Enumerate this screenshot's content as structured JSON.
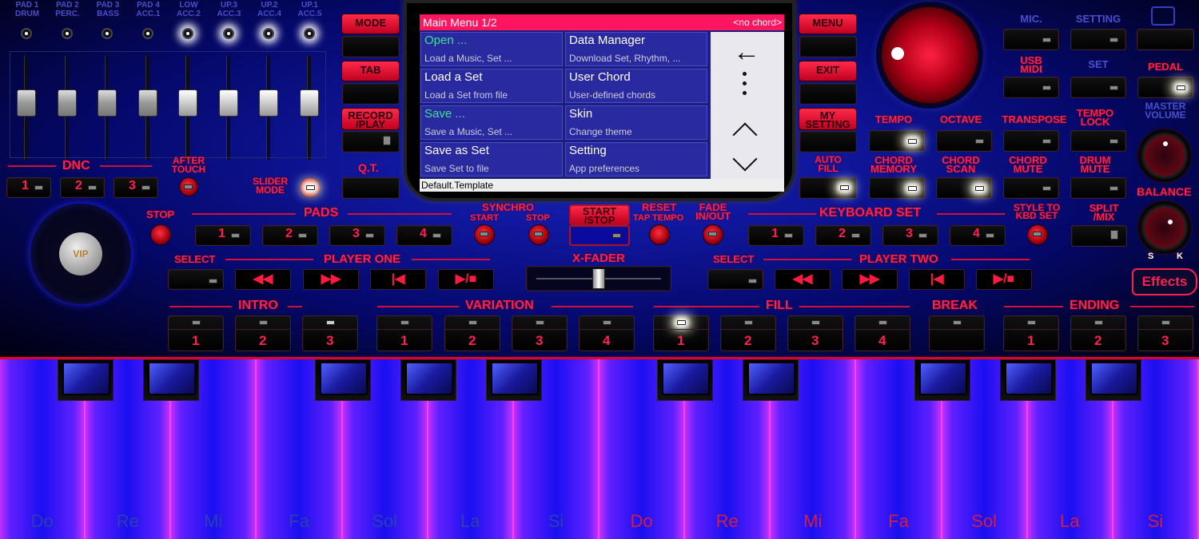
{
  "mixer": {
    "channels": [
      {
        "top": "PAD 1",
        "bottom": "DRUM",
        "led_on": false,
        "level": 0.4
      },
      {
        "top": "PAD 2",
        "bottom": "PERC.",
        "led_on": false,
        "level": 0.4
      },
      {
        "top": "PAD 3",
        "bottom": "BASS",
        "led_on": false,
        "level": 0.4
      },
      {
        "top": "PAD 4",
        "bottom": "ACC.1",
        "led_on": false,
        "level": 0.4
      },
      {
        "top": "LOW",
        "bottom": "ACC.2",
        "led_on": true,
        "level": 0.4
      },
      {
        "top": "UP.3",
        "bottom": "ACC.3",
        "led_on": true,
        "level": 0.4
      },
      {
        "top": "UP.2",
        "bottom": "ACC.4",
        "led_on": true,
        "level": 0.4
      },
      {
        "top": "UP.1",
        "bottom": "ACC.5",
        "led_on": true,
        "level": 0.4
      }
    ]
  },
  "dnc": {
    "label": "DNC",
    "buttons": [
      "1",
      "2",
      "3"
    ],
    "after_touch": "AFTER\nTOUCH",
    "slider_mode": "SLIDER\nMODE"
  },
  "left_buttons": {
    "mode": "MODE",
    "tab": "TAB",
    "record_play": "RECORD\n/PLAY",
    "qt": "Q.T."
  },
  "right_buttons": {
    "menu": "MENU",
    "exit": "EXIT",
    "my_setting": "MY\nSETTING",
    "auto_fill": "AUTO\nFILL"
  },
  "screen": {
    "title": "Main Menu  1/2",
    "chord": "<no chord>",
    "items": [
      {
        "title": "Open ...",
        "sub": "Load a Music, Set ...",
        "green": true
      },
      {
        "title": "Data Manager",
        "sub": "Download Set, Rhythm, ...",
        "green": false
      },
      {
        "title": "Load a Set",
        "sub": "Load a Set from file",
        "green": false
      },
      {
        "title": "User Chord",
        "sub": "User-defined chords",
        "green": false
      },
      {
        "title": "Save ...",
        "sub": "Save a Music, Set ...",
        "green": true
      },
      {
        "title": "Skin",
        "sub": "Change theme",
        "green": false
      },
      {
        "title": "Save as Set",
        "sub": "Save Set to file",
        "green": false
      },
      {
        "title": "Setting",
        "sub": "App preferences",
        "green": false
      }
    ],
    "footer": "Default.Template"
  },
  "right_panel": {
    "row1": [
      "MIC.",
      "SETTING"
    ],
    "row2": [
      "USB\nMIDI",
      "SET",
      "PEDAL"
    ],
    "row3": [
      "TEMPO",
      "OCTAVE",
      "TRANSPOSE",
      "TEMPO\nLOCK"
    ],
    "master_volume": "MASTER\nVOLUME",
    "row4": [
      "CHORD\nMEMORY",
      "CHORD\nSCAN",
      "CHORD\nMUTE",
      "DRUM\nMUTE"
    ],
    "balance": "BALANCE",
    "balance_s": "S",
    "balance_k": "K"
  },
  "pads": {
    "stop": "STOP",
    "label": "PADS",
    "buttons": [
      "1",
      "2",
      "3",
      "4"
    ]
  },
  "synchro": {
    "label": "SYNCHRO",
    "start": "START",
    "stop": "STOP"
  },
  "start_stop": "START\n/STOP",
  "reset": {
    "label": "RESET",
    "sub": "TAP TEMPO"
  },
  "fade": "FADE\nIN/OUT",
  "keyboard_set": {
    "label": "KEYBOARD SET",
    "buttons": [
      "1",
      "2",
      "3",
      "4"
    ],
    "style_to_kbd": "STYLE TO\nKBD SET",
    "split_mix": "SPLIT\n/MIX"
  },
  "player_one": {
    "select": "SELECT",
    "label": "PLAYER ONE"
  },
  "player_two": {
    "select": "SELECT",
    "label": "PLAYER TWO"
  },
  "xfader": {
    "label": "X-FADER",
    "value": 0.5
  },
  "effects": "Effects",
  "logo": "VIP",
  "style_sections": {
    "intro": {
      "label": "INTRO",
      "buttons": [
        "1",
        "2",
        "3"
      ]
    },
    "variation": {
      "label": "VARIATION",
      "buttons": [
        "1",
        "2",
        "3",
        "4"
      ]
    },
    "fill": {
      "label": "FILL",
      "buttons": [
        "1",
        "2",
        "3",
        "4"
      ]
    },
    "break": {
      "label": "BREAK"
    },
    "ending": {
      "label": "ENDING",
      "buttons": [
        "1",
        "2",
        "3"
      ]
    }
  },
  "keyboard": {
    "notes": [
      "Do",
      "Re",
      "Mi",
      "Fa",
      "Sol",
      "La",
      "Si",
      "Do",
      "Re",
      "Mi",
      "Fa",
      "Sol",
      "La",
      "Si"
    ]
  },
  "colors": {
    "accent": "#ff2050",
    "panel": "#0d1390",
    "screen_title": "#ff1560"
  }
}
